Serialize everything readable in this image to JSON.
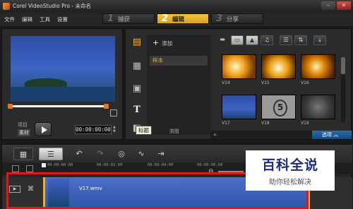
{
  "window": {
    "title": "Corel VideoStudio Pro - 未命名",
    "minimize": "–",
    "close": "✕"
  },
  "menu": [
    "文件",
    "编辑",
    "工具",
    "设置"
  ],
  "steps": [
    {
      "num": "1",
      "label": "捕获"
    },
    {
      "num": "2",
      "label": "编辑"
    },
    {
      "num": "3",
      "label": "分享"
    }
  ],
  "preview": {
    "mode_project": "项目",
    "mode_clip": "素材",
    "timecode": "00:00:00:00"
  },
  "library": {
    "add_label": "添加",
    "folder": "样本",
    "browse": "浏览",
    "tooltip": "标题",
    "options": "选项",
    "thumbs": [
      "V14",
      "V15",
      "V16",
      "V17",
      "V18",
      "V19"
    ]
  },
  "timeline": {
    "ruler": [
      "00:00:00:00",
      "00:00:02:00",
      "00:00:04:00",
      "00:00:06:00"
    ],
    "clip_name": "V17.wmv"
  },
  "watermark": {
    "title": "百科全说",
    "subtitle": "助你轻松解决"
  }
}
